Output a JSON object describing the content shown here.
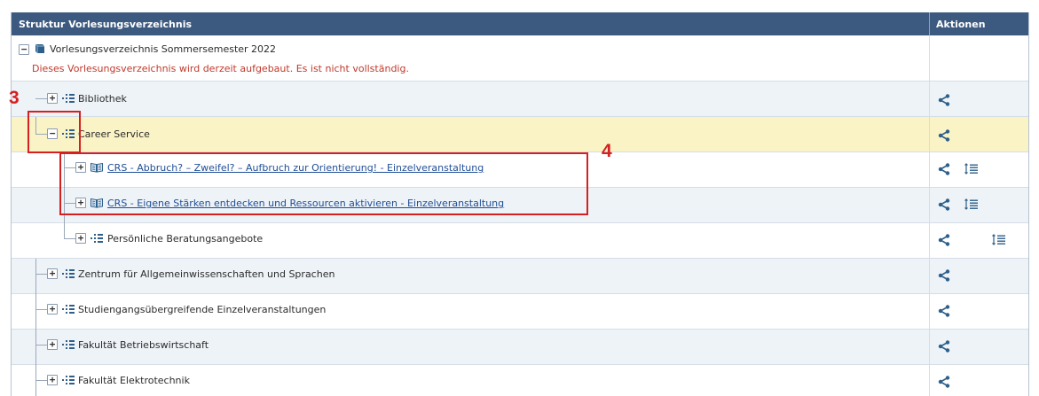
{
  "header": {
    "title": "Struktur Vorlesungsverzeichnis",
    "actions": "Aktionen"
  },
  "root": {
    "label": "Vorlesungsverzeichnis Sommersemester 2022",
    "notice": "Dieses Vorlesungsverzeichnis wird derzeit aufgebaut. Es ist nicht vollständig."
  },
  "nodes": {
    "bibliothek": "Bibliothek",
    "career_service": "Career Service",
    "crs_abbruch": "CRS - Abbruch? – Zweifel? – Aufbruch zur Orientierung! - Einzelveranstaltung",
    "crs_staerken": "CRS - Eigene Stärken entdecken und Ressourcen aktivieren - Einzelveranstaltung",
    "beratung": "Persönliche Beratungsangebote",
    "zentrum": "Zentrum für Allgemeinwissenschaften und Sprachen",
    "studiengang": "Studiengangsübergreifende Einzelveranstaltungen",
    "bwl": "Fakultät Betriebswirtschaft",
    "etechnik": "Fakultät Elektrotechnik"
  },
  "toggles": {
    "expanded": "−",
    "collapsed": "+"
  },
  "annotations": {
    "step3": "3",
    "step4": "4"
  },
  "colors": {
    "header_bg": "#3c5a80",
    "highlight_row": "#faf3c6",
    "annotation": "#d42020",
    "link": "#1f4e96"
  }
}
